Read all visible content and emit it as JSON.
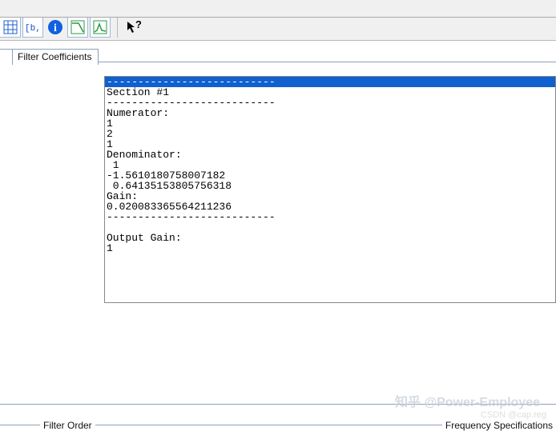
{
  "toolbar": {
    "icons": [
      "grid-icon",
      "spectrum-icon",
      "info-icon",
      "response-icon",
      "magnitude-icon",
      "help-arrow-icon"
    ]
  },
  "tabs": {
    "active": "Filter Coefficients"
  },
  "output": {
    "highlighted": "---------------------------",
    "lines": [
      "Section #1",
      "---------------------------",
      "Numerator:",
      "1",
      "2",
      "1",
      "Denominator:",
      " 1",
      "-1.5610180758007182",
      " 0.64135153805756318",
      "Gain:",
      "0.020083365564211236",
      "---------------------------",
      "",
      "Output Gain:",
      "1"
    ]
  },
  "bottom": {
    "left": "Filter Order",
    "right": "Frequency Specifications"
  },
  "watermarks": {
    "w1": "知乎 @Power-Employee",
    "w2": "CSDN @cap.reg"
  }
}
